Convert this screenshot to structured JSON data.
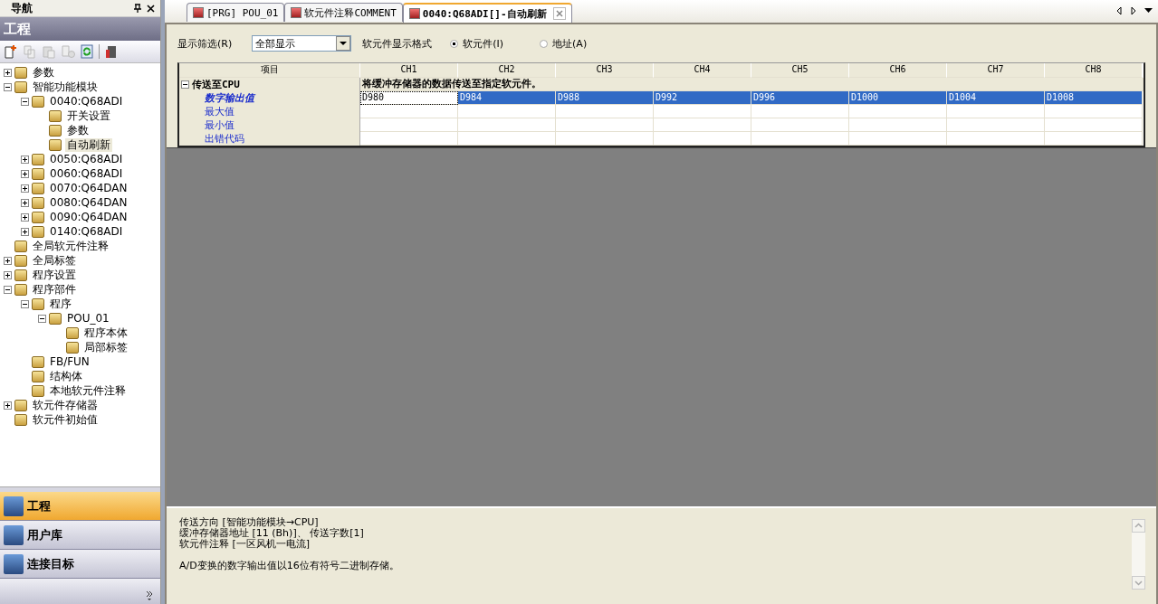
{
  "nav": {
    "title": "导航",
    "section": "工程",
    "tree": [
      {
        "label": "参数",
        "expanded": false,
        "selected": false
      },
      {
        "label": "智能功能模块",
        "expanded": true,
        "selected": false,
        "children": [
          {
            "label": "0040:Q68ADI",
            "expanded": true,
            "selected": false,
            "children": [
              {
                "label": "开关设置",
                "selected": false
              },
              {
                "label": "参数",
                "selected": false
              },
              {
                "label": "自动刷新",
                "selected": true
              }
            ]
          },
          {
            "label": "0050:Q68ADI",
            "expanded": false,
            "selected": false
          },
          {
            "label": "0060:Q68ADI",
            "expanded": false,
            "selected": false
          },
          {
            "label": "0070:Q64DAN",
            "expanded": false,
            "selected": false
          },
          {
            "label": "0080:Q64DAN",
            "expanded": false,
            "selected": false
          },
          {
            "label": "0090:Q64DAN",
            "expanded": false,
            "selected": false
          },
          {
            "label": "0140:Q68ADI",
            "expanded": false,
            "selected": false
          }
        ]
      },
      {
        "label": "全局软元件注释",
        "selected": false
      },
      {
        "label": "全局标签",
        "expanded": false,
        "selected": false
      },
      {
        "label": "程序设置",
        "expanded": false,
        "selected": false
      },
      {
        "label": "程序部件",
        "expanded": true,
        "selected": false,
        "children": [
          {
            "label": "程序",
            "expanded": true,
            "selected": false,
            "children": [
              {
                "label": "POU_01",
                "expanded": true,
                "selected": false,
                "children": [
                  {
                    "label": "程序本体",
                    "selected": false
                  },
                  {
                    "label": "局部标签",
                    "selected": false
                  }
                ]
              }
            ]
          },
          {
            "label": "FB/FUN",
            "selected": false
          },
          {
            "label": "结构体",
            "selected": false
          },
          {
            "label": "本地软元件注释",
            "selected": false
          }
        ]
      },
      {
        "label": "软元件存储器",
        "expanded": false,
        "selected": false
      },
      {
        "label": "软元件初始值",
        "selected": false
      }
    ],
    "buttons": [
      {
        "label": "工程",
        "selected": true
      },
      {
        "label": "用户库",
        "selected": false
      },
      {
        "label": "连接目标",
        "selected": false
      }
    ]
  },
  "tabs": [
    {
      "label": "[PRG] POU_01",
      "selected": false
    },
    {
      "label": "软元件注释COMMENT",
      "selected": false
    },
    {
      "label": "0040:Q68ADI[]-自动刷新",
      "selected": true
    }
  ],
  "filter": {
    "label": "显示筛选(R)",
    "value": "全部显示",
    "format_label": "软元件显示格式",
    "options": [
      {
        "label": "软元件(I)",
        "selected": true
      },
      {
        "label": "地址(A)",
        "selected": false
      }
    ]
  },
  "grid": {
    "columns": [
      "项目",
      "CH1",
      "CH2",
      "CH3",
      "CH4",
      "CH5",
      "CH6",
      "CH7",
      "CH8"
    ],
    "group": {
      "label": "传送至CPU",
      "expanded": true,
      "description": "将缓冲存储器的数据传送至指定软元件。"
    },
    "rows": [
      {
        "label": "数字输出值",
        "selected": true,
        "cells": [
          {
            "text": "D980",
            "focused": true
          },
          {
            "text": "D984",
            "focused": false
          },
          {
            "text": "D988",
            "focused": false
          },
          {
            "text": "D992",
            "focused": false
          },
          {
            "text": "D996",
            "focused": false
          },
          {
            "text": "D1000",
            "focused": false
          },
          {
            "text": "D1004",
            "focused": false
          },
          {
            "text": "D1008",
            "focused": false
          }
        ]
      },
      {
        "label": "最大值",
        "selected": false
      },
      {
        "label": "最小值",
        "selected": false
      },
      {
        "label": "出错代码",
        "selected": false
      }
    ]
  },
  "details": {
    "lines": [
      "传送方向 [智能功能模块→CPU]",
      "缓冲存储器地址 [11 (Bh)]、 传送字数[1]",
      "软元件注释 [一区风机一电流]"
    ],
    "note": "A/D变换的数字输出值以16位有符号二进制存储。"
  }
}
